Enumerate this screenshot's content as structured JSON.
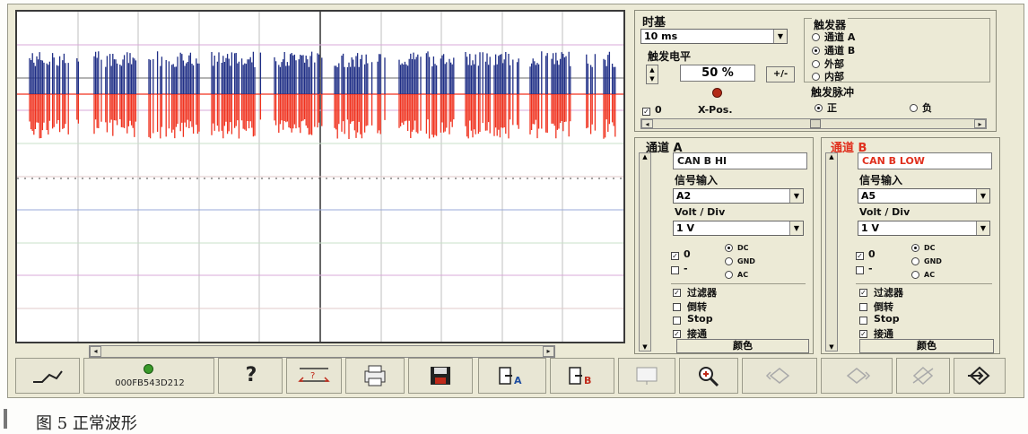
{
  "timebase": {
    "title": "时基",
    "value": "10 ms"
  },
  "trigger_level": {
    "title": "触发电平",
    "value": "50 %",
    "invert_label": "+/-"
  },
  "trigger_source": {
    "title": "触发器",
    "options": [
      "通道 A",
      "通道 B",
      "外部",
      "内部"
    ],
    "selected": "通道 B"
  },
  "trigger_pulse": {
    "title": "触发脉冲",
    "options": [
      "正",
      "负"
    ],
    "selected": "正"
  },
  "xpos": {
    "check": "0",
    "label": "X-Pos."
  },
  "channel_a": {
    "title": "通道 A",
    "title_color": "#1a1a1a",
    "name": "CAN B HI",
    "name_color": "#1a1a1a",
    "signal_input_label": "信号输入",
    "signal_input": "A2",
    "volt_div_label": "Volt / Div",
    "volt_div": "1 V",
    "offset_check": "0",
    "minus_check": "-",
    "coupling": [
      "DC",
      "GND",
      "AC"
    ],
    "coupling_selected": "DC",
    "filter": "过滤器",
    "invert": "倒转",
    "stop": "Stop",
    "connect": "接通",
    "color_button": "颜色"
  },
  "channel_b": {
    "title": "通道 B",
    "title_color": "#e0301e",
    "name": "CAN B LOW",
    "name_color": "#e0301e",
    "signal_input_label": "信号输入",
    "signal_input": "A5",
    "volt_div_label": "Volt / Div",
    "volt_div": "1 V",
    "offset_check": "0",
    "minus_check": "-",
    "coupling": [
      "DC",
      "GND",
      "AC"
    ],
    "coupling_selected": "DC",
    "filter": "过滤器",
    "invert": "倒转",
    "stop": "Stop",
    "connect": "接通",
    "color_button": "颜色"
  },
  "toolbar": {
    "device_id": "000FB543D212",
    "help_label": "?",
    "ch_a_tag": "A",
    "ch_b_tag": "B"
  },
  "colors": {
    "trace_high": "#1f2e86",
    "trace_low": "#f0321e",
    "panel": "#ecead6"
  },
  "caption": "图 5   正常波形"
}
